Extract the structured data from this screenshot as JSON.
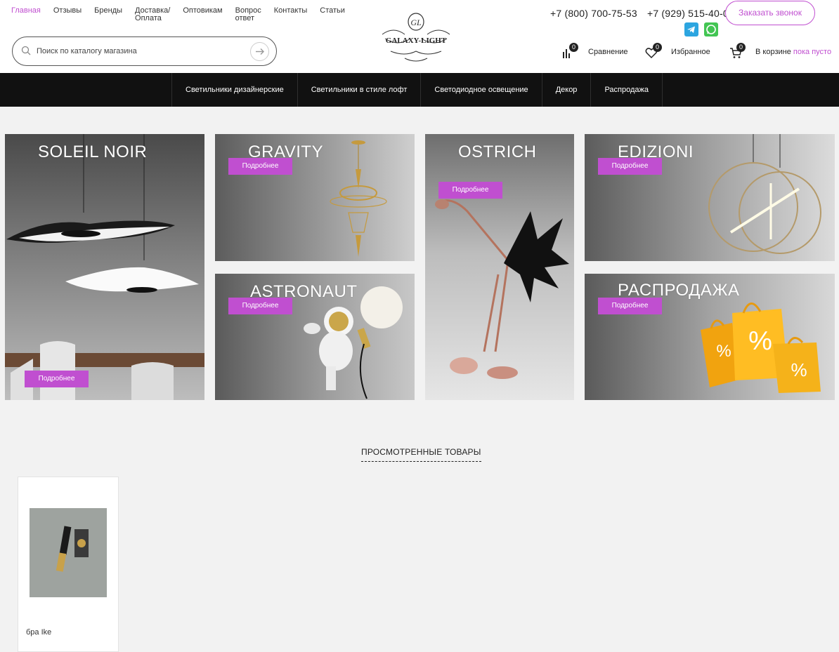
{
  "topnav": {
    "items": [
      "Главная",
      "Отзывы",
      "Бренды",
      "Доставка/\nОплата",
      "Оптовикам",
      "Вопрос\nответ",
      "Контакты",
      "Статьи"
    ],
    "active_index": 0
  },
  "search": {
    "placeholder": "Поиск по каталогу магазина"
  },
  "logo": {
    "text": "GALAXY-LIGHT",
    "monogram": "GL"
  },
  "contacts": {
    "phone1": "+7 (800) 700-75-53",
    "phone2": "+7 (929) 515-40-04",
    "callback_label": "Заказать звонок",
    "social": [
      "telegram-icon",
      "whatsapp-icon"
    ]
  },
  "user": {
    "compare_label": "Сравнение",
    "compare_count": "0",
    "favorites_label": "Избранное",
    "favorites_count": "0",
    "cart_label": "В корзине",
    "cart_status": "пока пусто",
    "cart_count": "0"
  },
  "catnav": [
    "Светильники дизайнерские",
    "Светильники в стиле лофт",
    "Светодиодное освещение",
    "Декор",
    "Распродажа"
  ],
  "banners": {
    "more_label": "Подробнее",
    "soleil": "SOLEIL NOIR",
    "gravity": "GRAVITY",
    "ostrich": "OSTRICH",
    "edizioni": "EDIZIONI",
    "astronaut": "ASTRONAUT",
    "sale": "РАСПРОДАЖА"
  },
  "viewed": {
    "title": "ПРОСМОТРЕННЫЕ ТОВАРЫ",
    "items": [
      {
        "name": "бра Ike"
      }
    ]
  },
  "colors": {
    "accent": "#c04fd0",
    "nav_bg": "#111111"
  }
}
